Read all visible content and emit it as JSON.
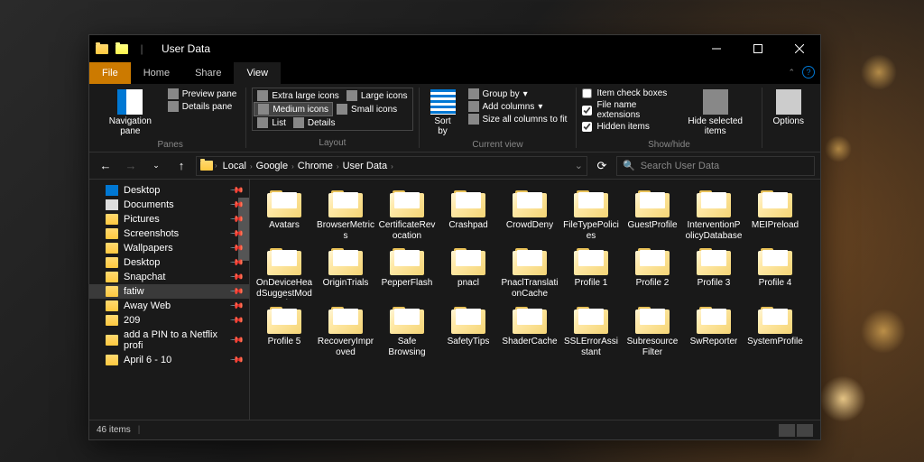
{
  "window": {
    "title": "User Data"
  },
  "tabs": {
    "file": "File",
    "home": "Home",
    "share": "Share",
    "view": "View",
    "active": "View"
  },
  "ribbon": {
    "panes": {
      "label": "Panes",
      "nav": "Navigation pane",
      "preview": "Preview pane",
      "details": "Details pane"
    },
    "layout": {
      "label": "Layout",
      "xl": "Extra large icons",
      "lg": "Large icons",
      "md": "Medium icons",
      "sm": "Small icons",
      "list": "List",
      "det": "Details"
    },
    "sort": {
      "label": "Current view",
      "sortby": "Sort by",
      "groupby": "Group by",
      "addcols": "Add columns",
      "sizeall": "Size all columns to fit"
    },
    "showhide": {
      "label": "Show/hide",
      "itemcheck": "Item check boxes",
      "fileext": "File name extensions",
      "hidden": "Hidden items",
      "hidesel": "Hide selected items"
    },
    "options": "Options"
  },
  "breadcrumbs": [
    "Local",
    "Google",
    "Chrome",
    "User Data"
  ],
  "search": {
    "placeholder": "Search User Data"
  },
  "sidebar": {
    "items": [
      {
        "label": "Desktop",
        "icon": "desktop",
        "pin": true
      },
      {
        "label": "Documents",
        "icon": "doc",
        "pin": true
      },
      {
        "label": "Pictures",
        "icon": "folder",
        "pin": true
      },
      {
        "label": "Screenshots",
        "icon": "folder",
        "pin": true
      },
      {
        "label": "Wallpapers",
        "icon": "folder",
        "pin": true
      },
      {
        "label": "Desktop",
        "icon": "folder",
        "pin": true
      },
      {
        "label": "Snapchat",
        "icon": "folder",
        "pin": true
      },
      {
        "label": "fatiw",
        "icon": "folder",
        "pin": true,
        "selected": true
      },
      {
        "label": "Away Web",
        "icon": "folder",
        "pin": true
      },
      {
        "label": "209",
        "icon": "folder",
        "pin": true
      },
      {
        "label": "add a PIN to a Netflix profi",
        "icon": "folder",
        "pin": true
      },
      {
        "label": "April 6 - 10",
        "icon": "folder",
        "pin": true
      }
    ]
  },
  "folders": [
    "Avatars",
    "BrowserMetrics",
    "CertificateRevocation",
    "Crashpad",
    "CrowdDeny",
    "FileTypePolicies",
    "GuestProfile",
    "InterventionPolicyDatabase",
    "MEIPreload",
    "OnDeviceHeadSuggestModel",
    "OriginTrials",
    "PepperFlash",
    "pnacl",
    "PnaclTranslationCache",
    "Profile 1",
    "Profile 2",
    "Profile 3",
    "Profile 4",
    "Profile 5",
    "RecoveryImproved",
    "Safe Browsing",
    "SafetyTips",
    "ShaderCache",
    "SSLErrorAssistant",
    "Subresource Filter",
    "SwReporter",
    "SystemProfile"
  ],
  "status": {
    "count": "46 items"
  }
}
